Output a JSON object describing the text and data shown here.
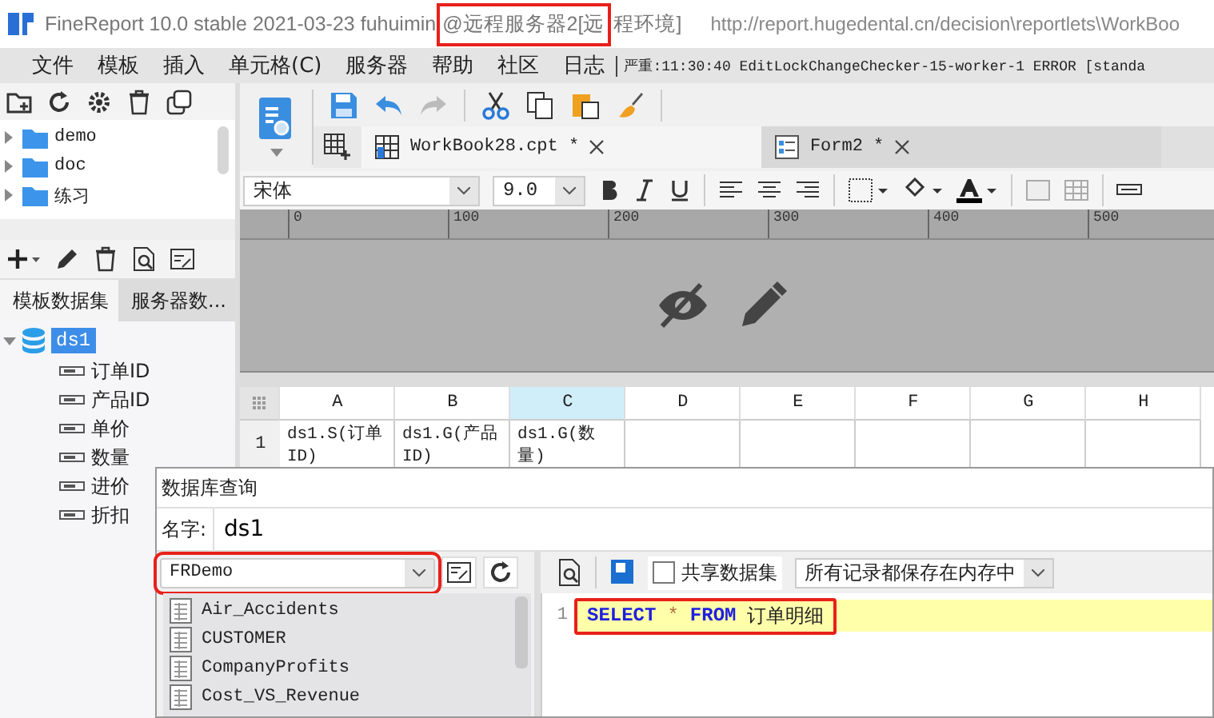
{
  "window": {
    "title_parts": [
      {
        "text": "FineReport 10.0 stable 2021-03-23 fuhuimin",
        "highlighted": false
      },
      {
        "text": "@远程服务器2[远",
        "highlighted": true
      },
      {
        "text": "程环境]",
        "highlighted": false
      }
    ],
    "url": "http://report.hugedental.cn/decision\\reportlets\\WorkBoo"
  },
  "menu": {
    "items": [
      "文件",
      "模板",
      "插入",
      "单元格(C)",
      "服务器",
      "帮助",
      "社区",
      "日志"
    ],
    "log": "严重:11:30:40 EditLockChangeChecker-15-worker-1 ERROR [standa"
  },
  "file_tree": [
    {
      "label": "demo",
      "expanded": false
    },
    {
      "label": "doc",
      "expanded": false
    },
    {
      "label": "练习",
      "expanded": false
    }
  ],
  "dataset_tabs": [
    {
      "label": "模板数据集",
      "selected": true
    },
    {
      "label": "服务器数...",
      "selected": false
    }
  ],
  "dataset_tree": {
    "label": "ds1",
    "selected": true,
    "expanded": true,
    "children": [
      {
        "label": "订单ID"
      },
      {
        "label": "产品ID"
      },
      {
        "label": "单价"
      },
      {
        "label": "数量"
      },
      {
        "label": "进价"
      },
      {
        "label": "折扣"
      }
    ]
  },
  "editor_tabs": [
    {
      "label": "WorkBook28.cpt *",
      "selected": true,
      "kind": "report"
    },
    {
      "label": "Form2 *",
      "selected": false,
      "kind": "form"
    }
  ],
  "format": {
    "font": "宋体",
    "size": "9.0"
  },
  "ruler": [
    "0",
    "100",
    "200",
    "300",
    "400",
    "500"
  ],
  "grid": {
    "columns": [
      {
        "label": "A",
        "selected": false
      },
      {
        "label": "B",
        "selected": false
      },
      {
        "label": "C",
        "selected": true
      },
      {
        "label": "D",
        "selected": false
      },
      {
        "label": "E",
        "selected": false
      },
      {
        "label": "F",
        "selected": false
      },
      {
        "label": "G",
        "selected": false
      },
      {
        "label": "H",
        "selected": false
      }
    ],
    "rows": [
      {
        "number": "1",
        "cells": [
          "ds1.S(订单ID)",
          "ds1.G(产品ID)",
          "ds1.G(数量)",
          "",
          "",
          "",
          "",
          ""
        ]
      }
    ]
  },
  "dialog": {
    "title": "数据库查询",
    "name_label": "名字:",
    "name_value": "ds1",
    "connection": {
      "value": "FRDemo",
      "highlighted": true
    },
    "tables": [
      "Air_Accidents",
      "CUSTOMER",
      "CompanyProfits",
      "Cost_VS_Revenue"
    ],
    "share_checkbox": {
      "label": "共享数据集",
      "checked": false
    },
    "cache_mode": "所有记录都保存在内存中",
    "sql_lines": [
      {
        "number": "1",
        "highlighted": true,
        "tokens": [
          {
            "text": "SELECT",
            "kind": "keyword"
          },
          {
            "text": "*",
            "kind": "operator"
          },
          {
            "text": "FROM",
            "kind": "keyword"
          },
          {
            "text": "订单明细",
            "kind": "plain"
          }
        ]
      }
    ]
  }
}
